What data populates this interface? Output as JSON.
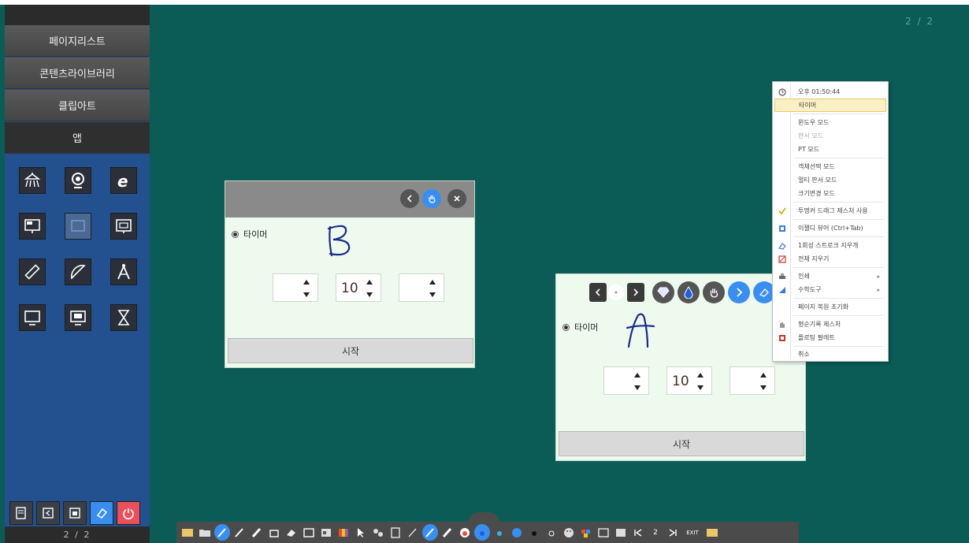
{
  "board": {
    "page_indicator": "2 / 2"
  },
  "sidebar": {
    "tabs": [
      "페이지리스트",
      "콘텐츠라이브러리",
      "클립아트",
      "앱"
    ],
    "apps": [
      "document-camera-icon",
      "webcam-icon",
      "internet-explorer-icon",
      "screen-share-icon",
      "screen-capture-icon",
      "presentation-icon",
      "ruler-icon",
      "protractor-icon",
      "compass-icon",
      "monitor-icon",
      "projector-icon",
      "hourglass-icon"
    ],
    "bottom_buttons": [
      "pages-icon",
      "back-icon",
      "window-icon",
      "eraser-icon",
      "power-icon"
    ],
    "page": "2 / 2"
  },
  "timer_left": {
    "radio_label": "타이머",
    "spin_values": [
      "",
      "10",
      ""
    ],
    "start_label": "시작",
    "handwriting": "B"
  },
  "timer_right": {
    "radio_label": "타이머",
    "spin_values": [
      "",
      "10",
      ""
    ],
    "start_label": "시작",
    "handwriting": "A"
  },
  "context_menu": {
    "items": [
      {
        "label": "오후 01:50:44",
        "icon": "clock-icon"
      },
      {
        "label": "타이머",
        "highlight": true
      },
      {
        "label": "윈도우 모드"
      },
      {
        "label": "판서 모드",
        "disabled": true
      },
      {
        "label": "PT 모드"
      },
      {
        "label": "객체선택 모드"
      },
      {
        "label": "멀티 판서 모드"
      },
      {
        "label": "크기변경 모드"
      },
      {
        "label": "투명커 드래그 제스처 사용",
        "icon": "check-icon"
      },
      {
        "label": "이젤디 뷰어 (Ctrl+Tab)",
        "icon": "viewer-icon"
      },
      {
        "label": "1회성 스트로크 지우개",
        "icon": "stroke-eraser-icon"
      },
      {
        "label": "전체 지우기",
        "icon": "clear-all-icon"
      },
      {
        "label": "인쇄",
        "icon": "print-icon",
        "submenu": true
      },
      {
        "label": "수학도구",
        "icon": "math-tools-icon",
        "submenu": true
      },
      {
        "label": "페이지 복원 초기화"
      },
      {
        "label": "형순기록 제스처",
        "icon": "gesture-icon"
      },
      {
        "label": "플로팅 팔레트",
        "icon": "palette-icon"
      },
      {
        "label": "취소"
      }
    ]
  },
  "toolbar": {
    "exit_label": "EXIT",
    "page_label": "2"
  }
}
